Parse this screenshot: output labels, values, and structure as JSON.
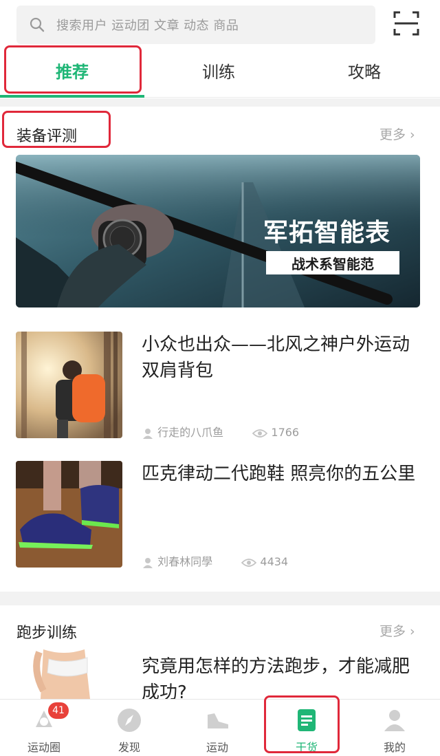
{
  "search": {
    "placeholder": "搜索用户 运动团 文章 动态 商品",
    "search_icon": "search-icon",
    "scan_icon": "scan-icon"
  },
  "tabs": [
    {
      "label": "推荐",
      "active": true
    },
    {
      "label": "训练",
      "active": false
    },
    {
      "label": "攻略",
      "active": false
    }
  ],
  "section_equipment": {
    "title": "装备评测",
    "more": "更多 ›",
    "banner": {
      "title": "军拓智能表",
      "subtitle": "战术系智能范"
    },
    "articles": [
      {
        "title": "小众也出众——北风之神户外运动双肩背包",
        "author": "行走的八爪鱼",
        "views": "1766"
      },
      {
        "title": "匹克律动二代跑鞋 照亮你的五公里",
        "author": "刘春林同學",
        "views": "4434"
      }
    ]
  },
  "section_running": {
    "title": "跑步训练",
    "more": "更多 ›",
    "articles": [
      {
        "title": "究竟用怎样的方法跑步，才能减肥成功?"
      }
    ]
  },
  "bottom_nav": [
    {
      "label": "运动圈",
      "icon": "circle-community-icon",
      "badge": "41",
      "active": false
    },
    {
      "label": "发现",
      "icon": "compass-icon",
      "active": false
    },
    {
      "label": "运动",
      "icon": "sneaker-icon",
      "active": false
    },
    {
      "label": "干货",
      "icon": "document-icon",
      "active": true
    },
    {
      "label": "我的",
      "icon": "user-icon",
      "active": false
    }
  ],
  "colors": {
    "accent": "#1fb676",
    "highlight_box": "#e0283a",
    "badge": "#e8413a"
  }
}
